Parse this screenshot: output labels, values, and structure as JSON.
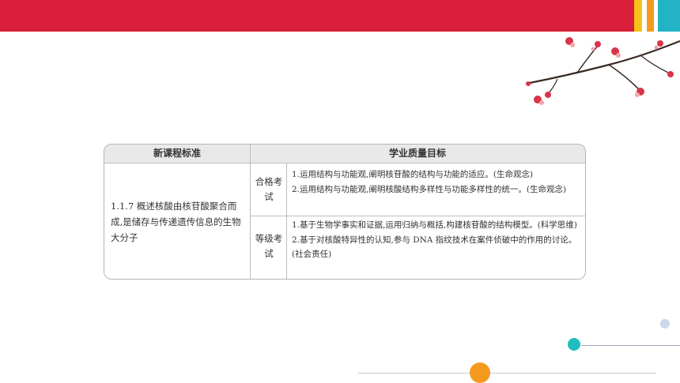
{
  "colors": {
    "top_bar": "#d81e3a",
    "accent_yellow": "#f6c21a",
    "accent_orange": "#f39a1e",
    "accent_teal": "#22b3c4",
    "dot_teal": "#1fbdbd",
    "dot_orange": "#f39a1e",
    "dot_light": "#c9d8ea"
  },
  "table": {
    "header_left": "新课程标准",
    "header_right": "学业质量目标",
    "standard": "1.1.7 概述核酸由核苷酸聚合而成,是储存与传递遗传信息的生物大分子",
    "rows": [
      {
        "level": "合格考试",
        "goals": [
          "1.运用结构与功能观,阐明核苷酸的结构与功能的适应。(生命观念)",
          "2.运用结构与功能观,阐明核酸结构多样性与功能多样性的统一。(生命观念)"
        ]
      },
      {
        "level": "等级考试",
        "goals": [
          "1.基于生物学事实和证据,运用归纳与概括,构建核苷酸的结构模型。(科学思维)",
          "2.基于对核酸特异性的认知,参与 DNA 指纹技术在案件侦破中的作用的讨论。(社会责任)"
        ]
      }
    ]
  },
  "icons": [
    "plum-blossom-branch"
  ]
}
